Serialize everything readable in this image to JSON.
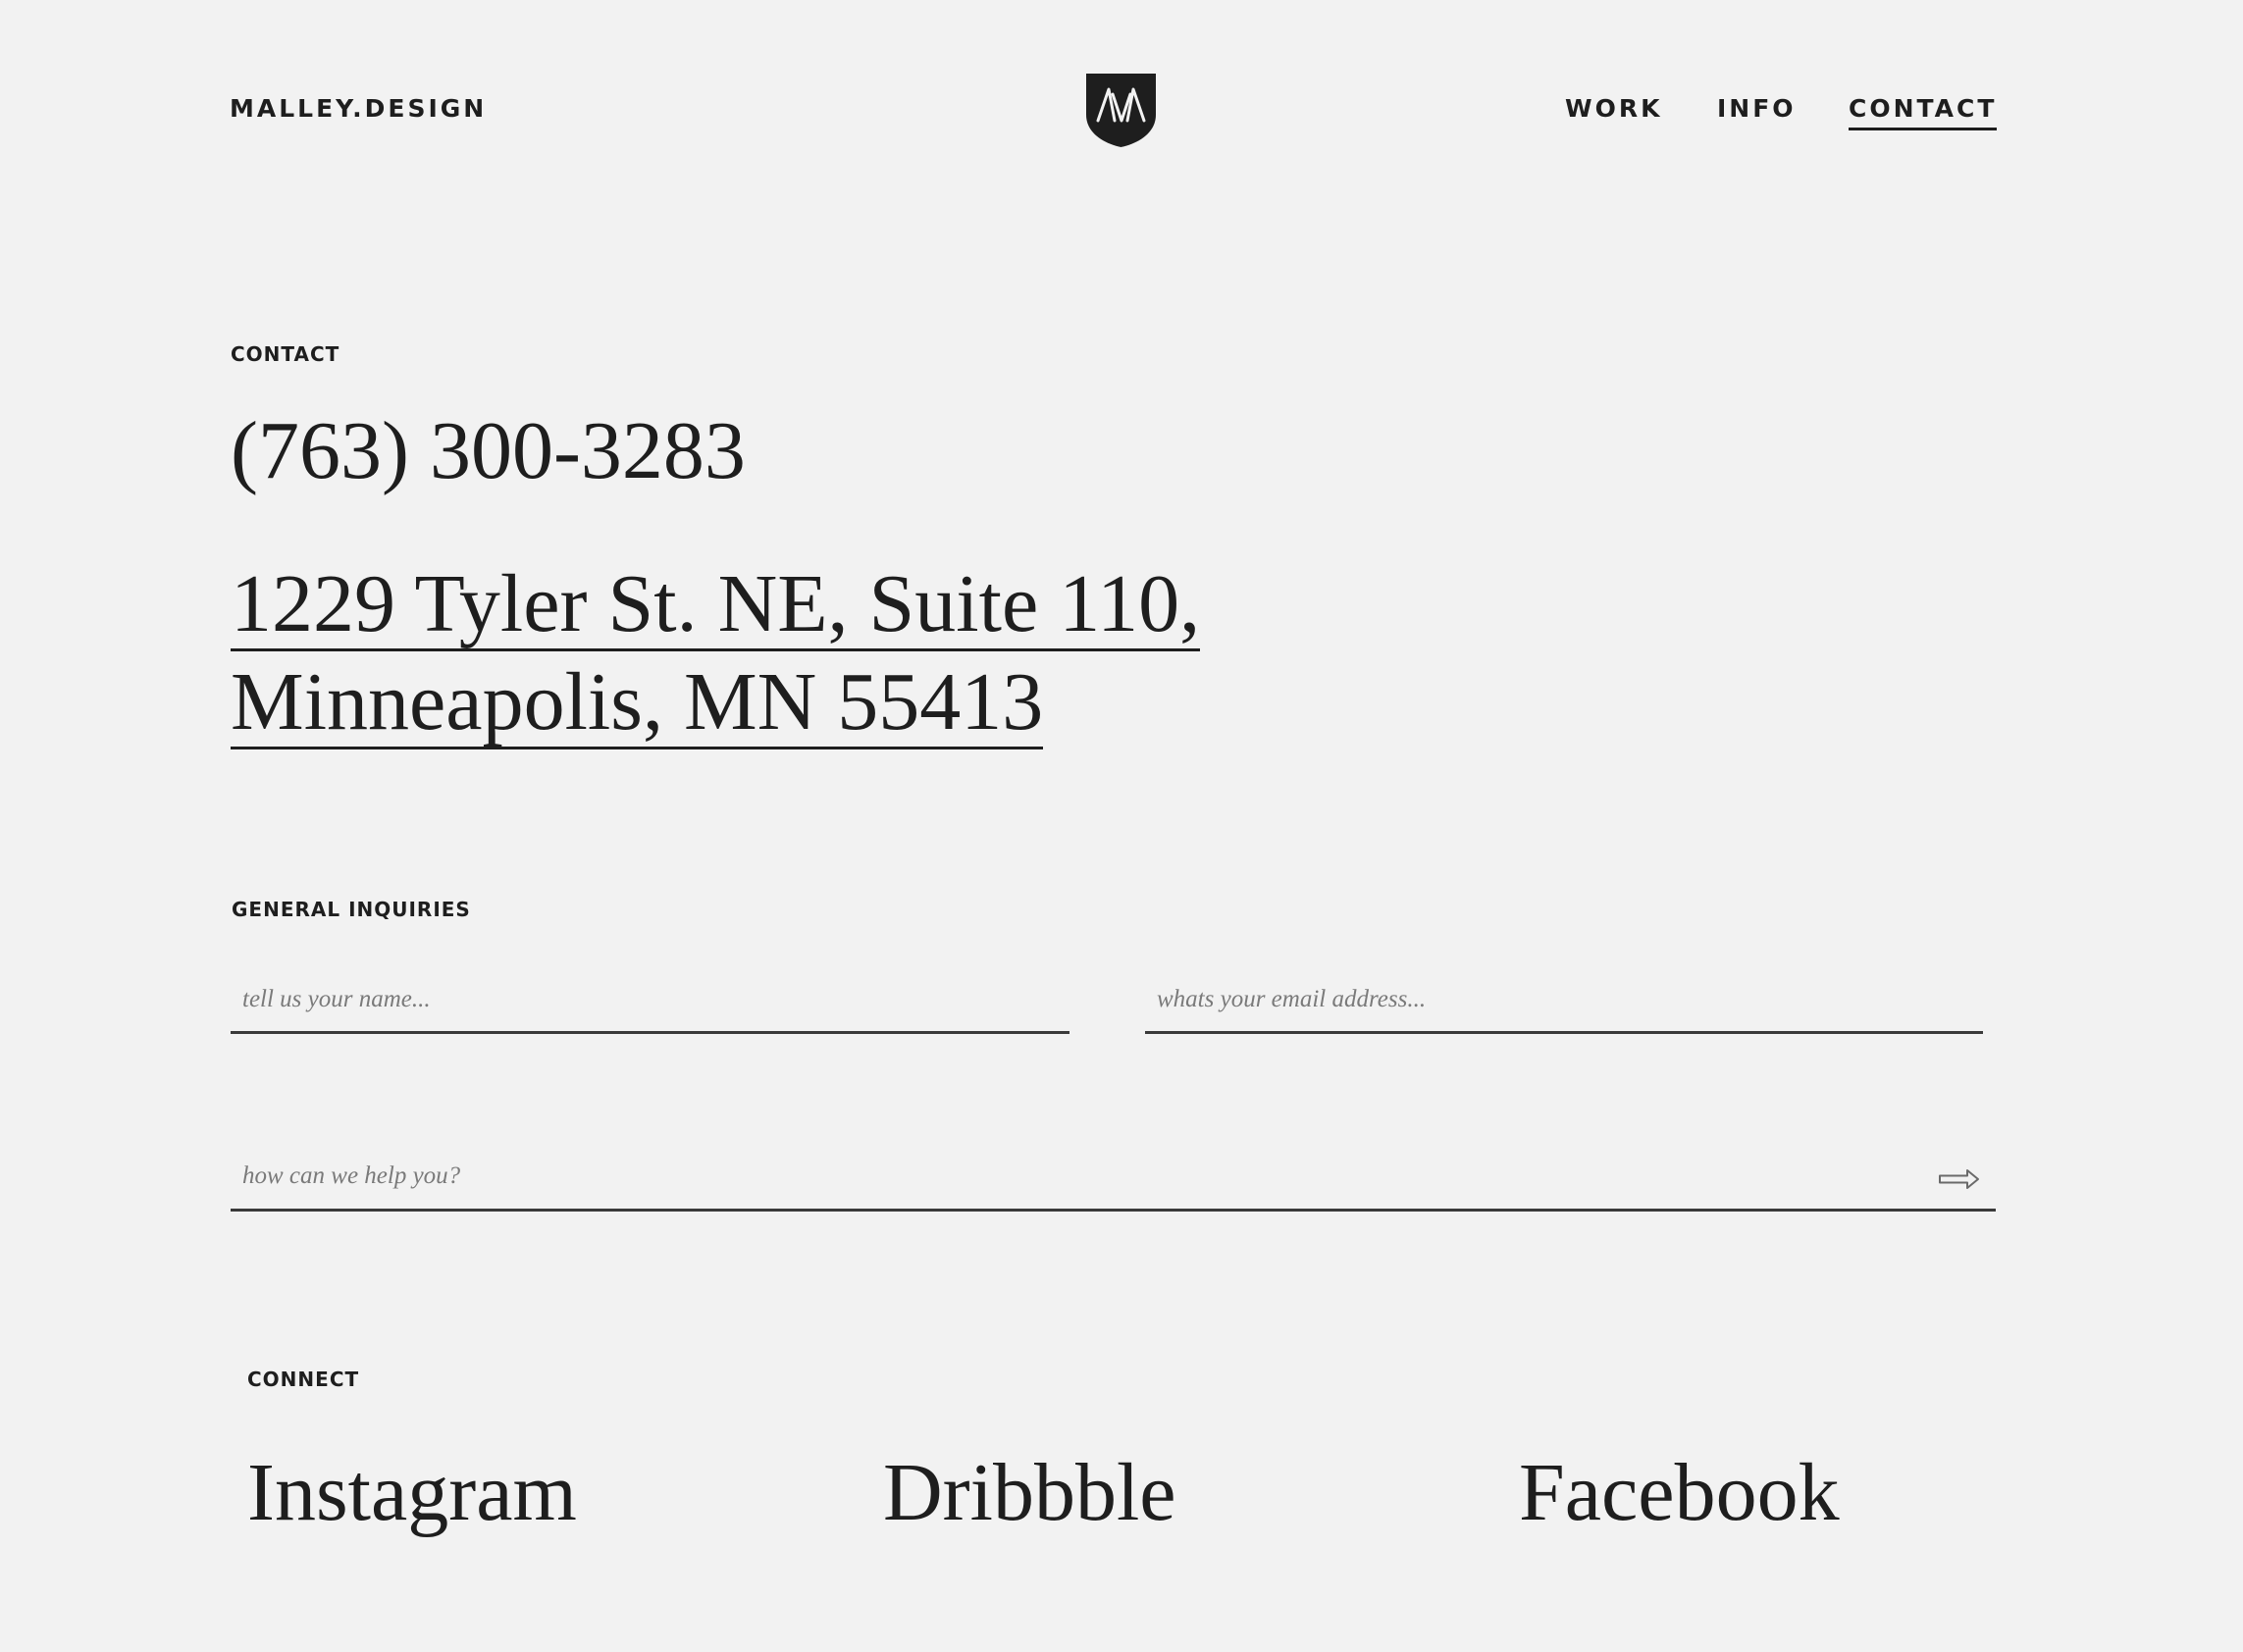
{
  "header": {
    "brand": "MALLEY.DESIGN",
    "logo_icon": "shield-monogram-icon",
    "nav": [
      {
        "label": "WORK"
      },
      {
        "label": "INFO"
      },
      {
        "label": "CONTACT",
        "active": true
      }
    ]
  },
  "contact": {
    "label": "CONTACT",
    "phone": "(763) 300-3283",
    "address_line1": "1229 Tyler St. NE, Suite 110,",
    "address_line2": "Minneapolis, MN 55413"
  },
  "inquiries": {
    "label": "GENERAL INQUIRIES",
    "name_placeholder": "tell us your name...",
    "email_placeholder": "whats your email address...",
    "message_placeholder": "how can we help you?",
    "submit_icon": "arrow-right-icon"
  },
  "connect": {
    "label": "CONNECT",
    "links": [
      "Instagram",
      "Dribbble",
      "Facebook"
    ]
  },
  "colors": {
    "background": "#f2f2f2",
    "text": "#1e1e1e",
    "placeholder": "#7a7a7a"
  }
}
